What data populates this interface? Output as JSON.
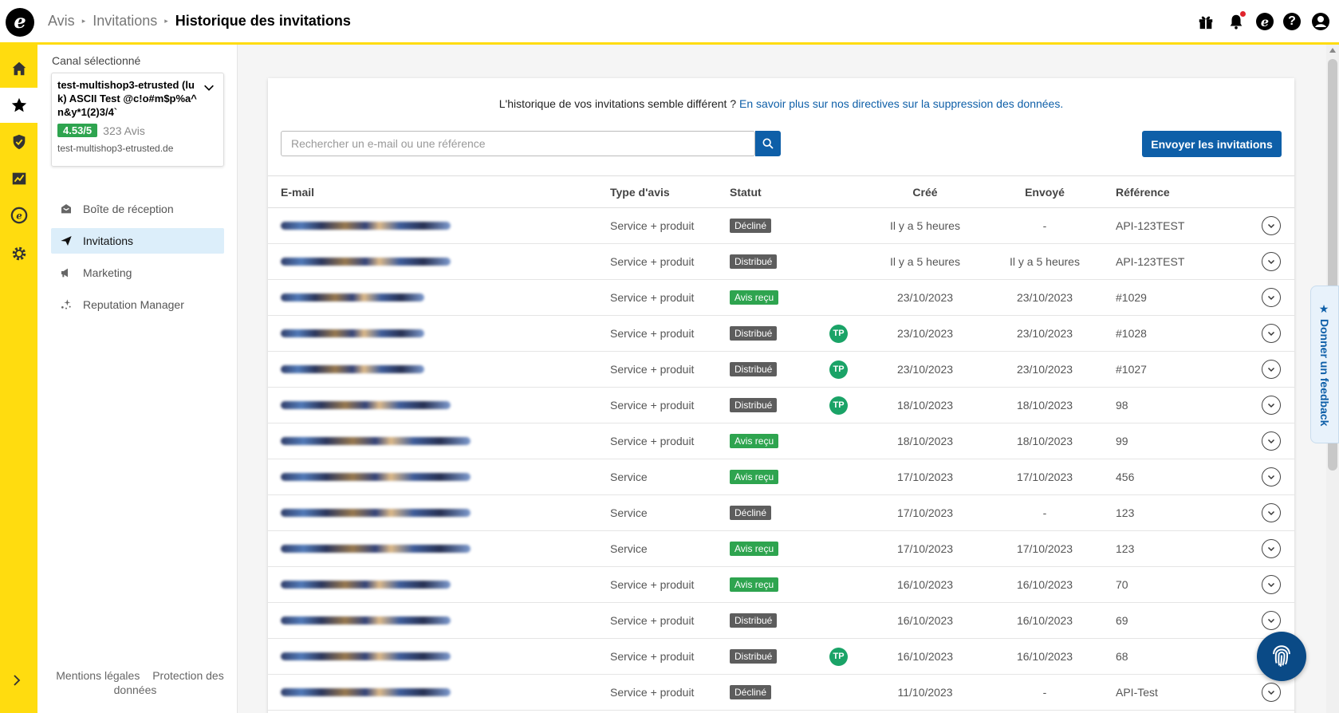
{
  "breadcrumb": {
    "items": [
      "Avis",
      "Invitations"
    ],
    "current": "Historique des invitations"
  },
  "sidebar": {
    "canal_label": "Canal sélectionné",
    "channel": {
      "name": "test-multishop3-etrusted (luk) ASCII Test @c!o#m$p%a^n&y*1(2)3/4`",
      "rating": "4.53/5",
      "reviews": "323 Avis",
      "domain": "test-multishop3-etrusted.de"
    },
    "nav": [
      {
        "label": "Boîte de réception",
        "icon": "inbox-icon"
      },
      {
        "label": "Invitations",
        "icon": "paper-plane-icon",
        "active": true
      },
      {
        "label": "Marketing",
        "icon": "megaphone-icon"
      },
      {
        "label": "Reputation Manager",
        "icon": "sparkle-icon"
      }
    ],
    "footer": [
      "Mentions légales",
      "Protection des données"
    ]
  },
  "main": {
    "notice_text": "L'historique de vos invitations semble différent ?",
    "notice_link": "En savoir plus sur nos directives sur la suppression des données.",
    "search_placeholder": "Rechercher un e-mail ou une référence",
    "send_button": "Envoyer les invitations",
    "table": {
      "headers": {
        "email": "E-mail",
        "type": "Type d'avis",
        "status": "Statut",
        "created": "Créé",
        "sent": "Envoyé",
        "reference": "Référence"
      },
      "rows": [
        {
          "email_len": 0.85,
          "type": "Service + produit",
          "status": "Décliné",
          "kind": "declined",
          "tp": false,
          "created": "Il y a 5 heures",
          "sent": "-",
          "ref": "API-123TEST"
        },
        {
          "email_len": 0.85,
          "type": "Service + produit",
          "status": "Distribué",
          "kind": "distributed",
          "tp": false,
          "created": "Il y a 5 heures",
          "sent": "Il y a 5 heures",
          "ref": "API-123TEST"
        },
        {
          "email_len": 0.72,
          "type": "Service + produit",
          "status": "Avis reçu",
          "kind": "received",
          "tp": false,
          "created": "23/10/2023",
          "sent": "23/10/2023",
          "ref": "#1029"
        },
        {
          "email_len": 0.72,
          "type": "Service + produit",
          "status": "Distribué",
          "kind": "distributed",
          "tp": true,
          "created": "23/10/2023",
          "sent": "23/10/2023",
          "ref": "#1028"
        },
        {
          "email_len": 0.72,
          "type": "Service + produit",
          "status": "Distribué",
          "kind": "distributed",
          "tp": true,
          "created": "23/10/2023",
          "sent": "23/10/2023",
          "ref": "#1027"
        },
        {
          "email_len": 0.85,
          "type": "Service + produit",
          "status": "Distribué",
          "kind": "distributed",
          "tp": true,
          "created": "18/10/2023",
          "sent": "18/10/2023",
          "ref": "98"
        },
        {
          "email_len": 0.95,
          "type": "Service + produit",
          "status": "Avis reçu",
          "kind": "received",
          "tp": false,
          "created": "18/10/2023",
          "sent": "18/10/2023",
          "ref": "99"
        },
        {
          "email_len": 0.95,
          "type": "Service",
          "status": "Avis reçu",
          "kind": "received",
          "tp": false,
          "created": "17/10/2023",
          "sent": "17/10/2023",
          "ref": "456"
        },
        {
          "email_len": 0.95,
          "type": "Service",
          "status": "Décliné",
          "kind": "declined",
          "tp": false,
          "created": "17/10/2023",
          "sent": "-",
          "ref": "123"
        },
        {
          "email_len": 0.95,
          "type": "Service",
          "status": "Avis reçu",
          "kind": "received",
          "tp": false,
          "created": "17/10/2023",
          "sent": "17/10/2023",
          "ref": "123"
        },
        {
          "email_len": 0.85,
          "type": "Service + produit",
          "status": "Avis reçu",
          "kind": "received",
          "tp": false,
          "created": "16/10/2023",
          "sent": "16/10/2023",
          "ref": "70"
        },
        {
          "email_len": 0.85,
          "type": "Service + produit",
          "status": "Distribué",
          "kind": "distributed",
          "tp": false,
          "created": "16/10/2023",
          "sent": "16/10/2023",
          "ref": "69"
        },
        {
          "email_len": 0.85,
          "type": "Service + produit",
          "status": "Distribué",
          "kind": "distributed",
          "tp": true,
          "created": "16/10/2023",
          "sent": "16/10/2023",
          "ref": "68"
        },
        {
          "email_len": 0.85,
          "type": "Service + produit",
          "status": "Décliné",
          "kind": "declined",
          "tp": false,
          "created": "11/10/2023",
          "sent": "-",
          "ref": "API-Test"
        }
      ],
      "tp_label": "TP"
    }
  },
  "feedback_tab": "★ Donner un feedback",
  "colors": {
    "brand_yellow": "#ffdc0f",
    "primary_blue": "#0e5fa8",
    "success_green": "#2ea44f",
    "badge_gray": "#5d5d5d"
  }
}
